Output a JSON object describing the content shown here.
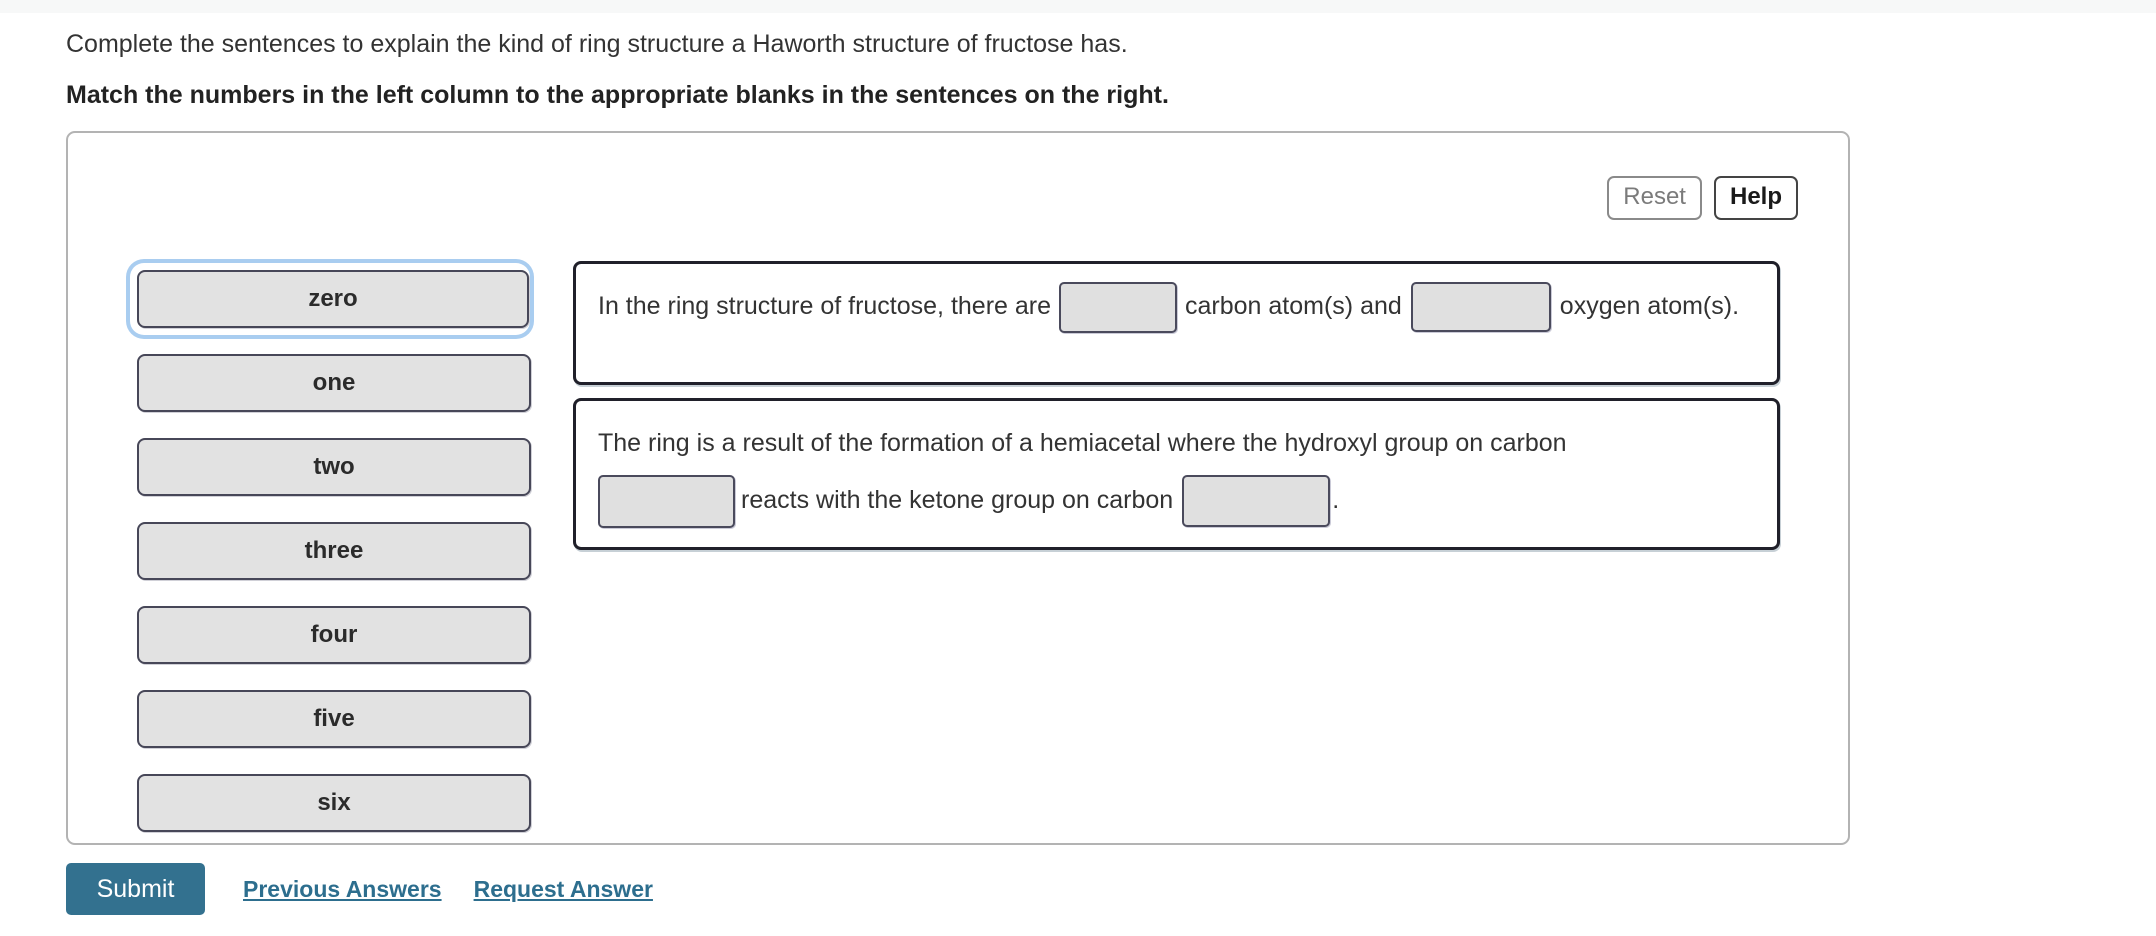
{
  "prompt": {
    "line1": "Complete the sentences to explain the kind of ring structure a Haworth structure of fructose has.",
    "line2": "Match the numbers in the left column to the appropriate blanks in the sentences on the right."
  },
  "toolbar": {
    "reset_label": "Reset",
    "help_label": "Help"
  },
  "choices": [
    {
      "label": "zero",
      "focused": true
    },
    {
      "label": "one",
      "focused": false
    },
    {
      "label": "two",
      "focused": false
    },
    {
      "label": "three",
      "focused": false
    },
    {
      "label": "four",
      "focused": false
    },
    {
      "label": "five",
      "focused": false
    },
    {
      "label": "six",
      "focused": false
    }
  ],
  "sentences": {
    "card1": {
      "frag1": "In the ring structure of fructose, there are",
      "frag2": "carbon atom(s) and",
      "frag3": "oxygen atom(s).",
      "blank1_value": "",
      "blank2_value": ""
    },
    "card2": {
      "frag1": "The ring is a result of the formation of a hemiacetal where the hydroxyl group on carbon",
      "frag2": "reacts with the ketone group on carbon",
      "frag3": ".",
      "blank1_value": "",
      "blank2_value": ""
    }
  },
  "footer": {
    "submit_label": "Submit",
    "previous_answers_label": "Previous Answers",
    "request_answer_label": "Request Answer"
  },
  "colors": {
    "accent": "#33718f",
    "link": "#2d6e8e",
    "choice_fill": "#e2e2e2",
    "choice_border": "#474758",
    "focus_ring": "#a9cdf0",
    "blank_fill": "#e0e0e0",
    "blank_border": "#4a4a5c",
    "panel_border": "#b3b3b3",
    "card_border": "#20202a",
    "text": "#333333"
  }
}
